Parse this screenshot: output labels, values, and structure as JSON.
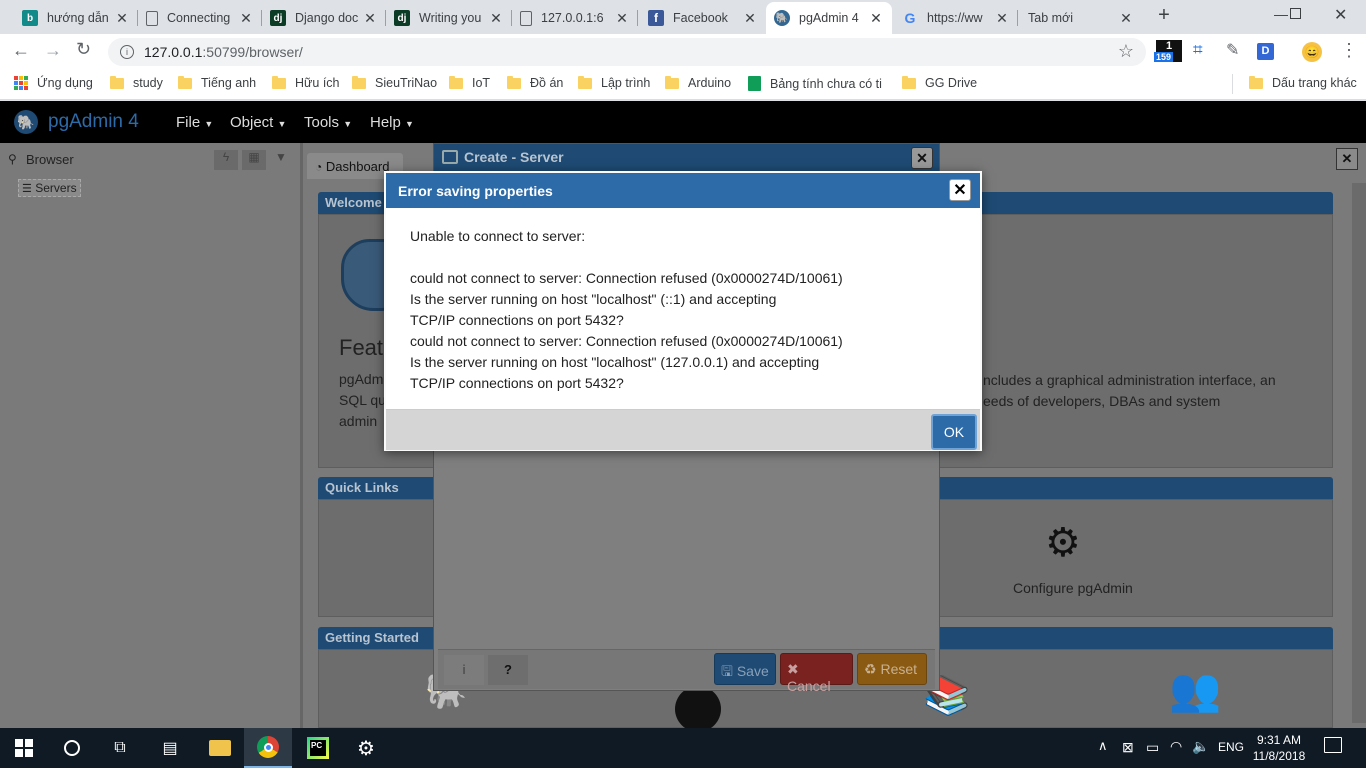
{
  "browser": {
    "tabs": [
      {
        "title": "hướng dẫn",
        "icon": "bing-icon",
        "color": "#138a8a"
      },
      {
        "title": "Connecting",
        "icon": "document-icon",
        "color": "#5f6368"
      },
      {
        "title": "Django doc",
        "icon": "django-icon",
        "color": "#0c3c26"
      },
      {
        "title": "Writing you",
        "icon": "django-icon",
        "color": "#0c3c26"
      },
      {
        "title": "127.0.0.1:6",
        "icon": "document-icon",
        "color": "#5f6368"
      },
      {
        "title": "Facebook",
        "icon": "facebook-icon",
        "color": "#3b5998"
      },
      {
        "title": "pgAdmin 4",
        "icon": "pgadmin-icon",
        "color": "#336791"
      },
      {
        "title": "https://ww",
        "icon": "google-icon",
        "color": "#4285f4"
      },
      {
        "title": "Tab mới",
        "icon": "",
        "color": ""
      }
    ],
    "url_host": "127.0.0.1",
    "url_rest": ":50799/browser/",
    "extension_badge": "159",
    "bookmarks": [
      {
        "label": "Ứng dụng",
        "icon": "apps-icon"
      },
      {
        "label": "study",
        "icon": "folder-icon"
      },
      {
        "label": "Tiếng anh",
        "icon": "folder-icon"
      },
      {
        "label": "Hữu ích",
        "icon": "folder-icon"
      },
      {
        "label": "SieuTriNao",
        "icon": "folder-icon"
      },
      {
        "label": "IoT",
        "icon": "folder-icon"
      },
      {
        "label": "Đồ án",
        "icon": "folder-icon"
      },
      {
        "label": "Lập trình",
        "icon": "folder-icon"
      },
      {
        "label": "Arduino",
        "icon": "folder-icon"
      },
      {
        "label": "Bảng tính chưa có tiê",
        "icon": "sheets-icon"
      },
      {
        "label": "GG Drive",
        "icon": "folder-icon"
      }
    ],
    "other_bookmarks": "Dấu trang khác"
  },
  "pgadmin": {
    "app_title": "pgAdmin 4",
    "menu": [
      "File",
      "Object",
      "Tools",
      "Help"
    ],
    "browser_panel_title": "Browser",
    "tree_root": "Servers",
    "dashboard_tab": "Dashboard",
    "welcome_title": "Welcome",
    "feature_heading": "Feat",
    "feature_text_left_1": "pgAdm",
    "feature_text_left_2": "SQL qu",
    "feature_text_left_3": "admin",
    "feature_text_right_1": "ncludes a graphical administration interface, an",
    "feature_text_right_2": "eeds of developers, DBAs and system",
    "quick_links_title": "Quick Links",
    "configure_label": "Configure pgAdmin",
    "getting_started_title": "Getting Started"
  },
  "create_dialog": {
    "title": "Create - Server",
    "info_label": "i",
    "help_label": "?",
    "save_label": "Save",
    "cancel_label": "Cancel",
    "reset_label": "Reset"
  },
  "error_dialog": {
    "title": "Error saving properties",
    "lines": [
      "Unable to connect to server:",
      "",
      "could not connect to server: Connection refused (0x0000274D/10061)",
      "Is the server running on host \"localhost\" (::1) and accepting",
      "TCP/IP connections on port 5432?",
      "could not connect to server: Connection refused (0x0000274D/10061)",
      "Is the server running on host \"localhost\" (127.0.0.1) and accepting",
      "TCP/IP connections on port 5432?"
    ],
    "ok_label": "OK"
  },
  "taskbar": {
    "language": "ENG",
    "time": "9:31 AM",
    "date": "11/8/2018"
  },
  "colors": {
    "pg_header": "#2c6aa8",
    "panel_header": "#1e4a73",
    "save_btn": "#2c6aa8",
    "cancel_btn": "#c9302c",
    "reset_btn": "#d98c1a"
  }
}
